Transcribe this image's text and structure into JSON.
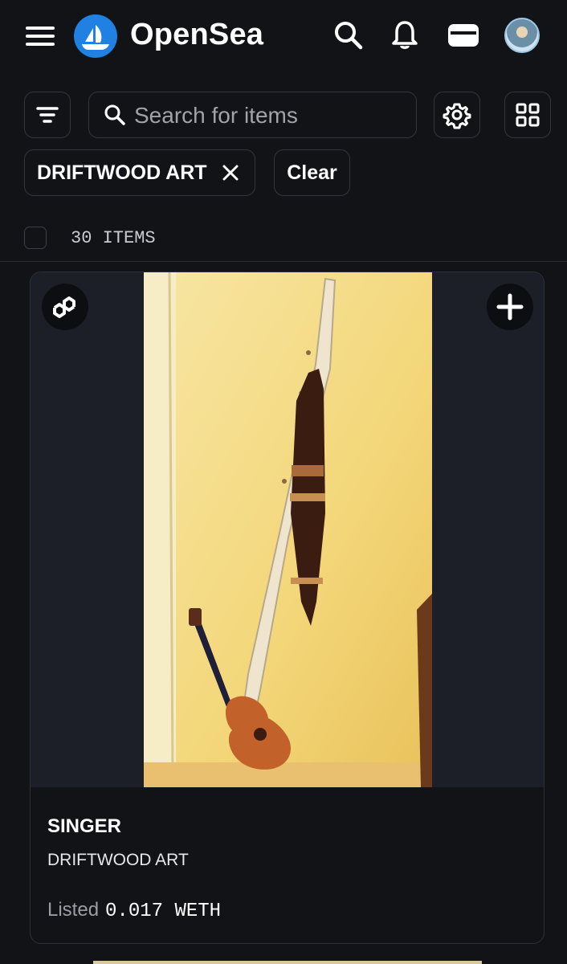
{
  "header": {
    "brand": "OpenSea",
    "menu_icon": "hamburger-menu-icon",
    "logo_icon": "opensea-ship-logo-icon",
    "search_icon": "search-icon",
    "notifications_icon": "bell-icon",
    "wallet_icon": "wallet-icon",
    "avatar": "user-avatar"
  },
  "toolbar": {
    "filter_icon": "filter-icon",
    "search_placeholder": "Search for items",
    "settings_icon": "gear-icon",
    "grid_icon": "grid-view-icon"
  },
  "filters": {
    "active_tag": "DRIFTWOOD ART",
    "remove_icon": "close-icon",
    "clear_label": "Clear"
  },
  "results": {
    "count_text": "30 ITEMS",
    "select_all_checked": false
  },
  "card": {
    "title": "SINGER",
    "collection": "DRIFTWOOD ART",
    "price_label": "Listed",
    "price_value": "0.017 WETH",
    "chain_icon": "polygon-chain-icon",
    "add_icon": "plus-icon"
  },
  "colors": {
    "background": "#121316",
    "accent": "#2081E2",
    "border": "#34363d",
    "muted_text": "#a0a3aa"
  }
}
